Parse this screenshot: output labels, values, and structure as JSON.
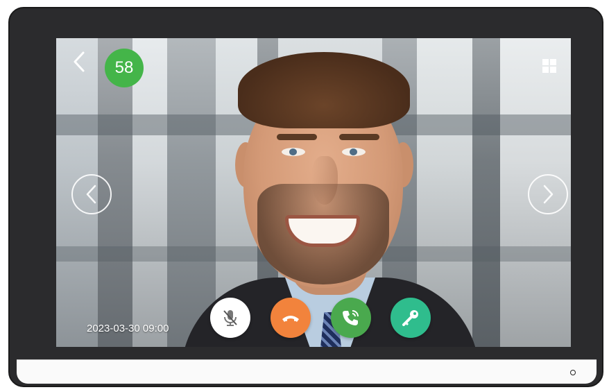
{
  "call": {
    "timer": "58",
    "datetime": "2023-03-30 09:00"
  },
  "icons": {
    "back": "chevron-left-icon",
    "layout": "grid-icon",
    "prev": "arrow-left-circle-icon",
    "next": "arrow-right-circle-icon",
    "mic": "microphone-muted-icon",
    "hangup": "phone-hangup-icon",
    "answer": "phone-ringing-icon",
    "unlock": "key-icon"
  },
  "colors": {
    "timer_badge": "#44b549",
    "hangup": "#f2833c",
    "answer": "#4aa94e",
    "unlock": "#2fbd8d",
    "mic": "#ffffff"
  }
}
